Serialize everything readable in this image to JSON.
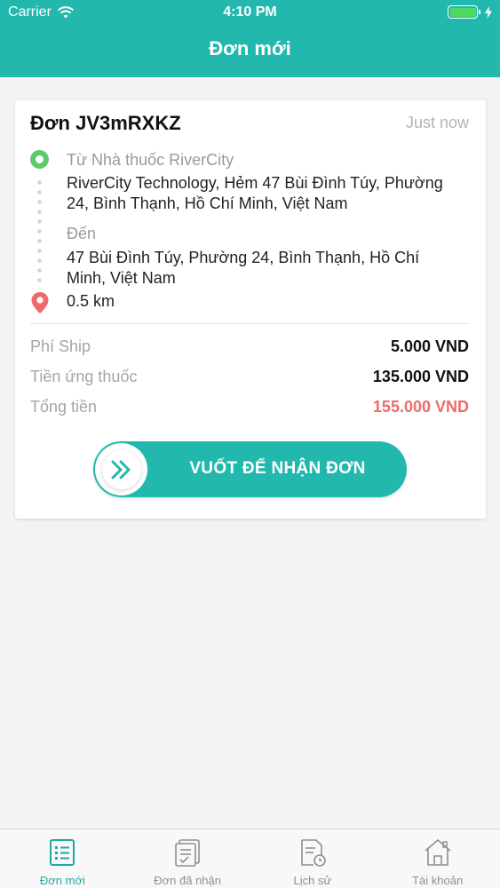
{
  "status_bar": {
    "carrier": "Carrier",
    "time": "4:10 PM"
  },
  "header": {
    "title": "Đơn mới"
  },
  "order": {
    "title": "Đơn JV3mRXKZ",
    "time": "Just now",
    "from_label": "Từ Nhà thuốc RiverCity",
    "from_address": "RiverCity Technology, Hẻm 47 Bùi Đình Túy, Phường 24, Bình Thạnh, Hồ Chí Minh, Việt Nam",
    "to_label": "Đến",
    "to_address": "47 Bùi Đình Túy, Phường 24, Bình Thạnh, Hồ Chí Minh, Việt Nam",
    "distance": "0.5 km",
    "fees": [
      {
        "label": "Phí Ship",
        "value": "5.000 VND"
      },
      {
        "label": "Tiền ứng thuốc",
        "value": "135.000 VND"
      },
      {
        "label": "Tổng tiền",
        "value": "155.000 VND"
      }
    ],
    "swipe_label": "VUỐT ĐỂ NHẬN ĐƠN"
  },
  "tabs": [
    {
      "label": "Đơn mới",
      "icon": "list-document-icon",
      "active": true
    },
    {
      "label": "Đơn đã nhận",
      "icon": "clipboard-check-icon",
      "active": false
    },
    {
      "label": "Lịch sử",
      "icon": "document-clock-icon",
      "active": false
    },
    {
      "label": "Tài khoản",
      "icon": "house-icon",
      "active": false
    }
  ],
  "colors": {
    "primary": "#22b8ae",
    "start_dot": "#5cc96c",
    "pin": "#ef6b6b",
    "total": "#ef6b6b"
  }
}
